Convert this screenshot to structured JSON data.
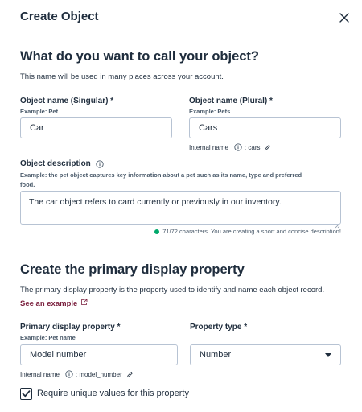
{
  "header": {
    "title": "Create Object"
  },
  "naming": {
    "heading": "What do you want to call your object?",
    "help": "This name will be used in many places across your account.",
    "singular": {
      "label": "Object name (Singular) *",
      "hint": "Example: Pet",
      "value": "Car"
    },
    "plural": {
      "label": "Object name (Plural) *",
      "hint": "Example: Pets",
      "value": "Cars"
    },
    "internal_name_label": "Internal name",
    "internal_name_value": ": cars",
    "description": {
      "label": "Object description",
      "hint_line1": "Example: the pet object captures key information about a pet such as its name, type and preferred",
      "hint_line2": "food.",
      "value": "The car object refers to card currently or previously in our inventory.",
      "counter": "71/72 characters. You are creating a short and concise description!"
    }
  },
  "display_property": {
    "heading": "Create the primary display property",
    "help": "The primary display property is the property used to identify and name each object record.",
    "link": "See an example",
    "primary": {
      "label": "Primary display property *",
      "hint": "Example: Pet name",
      "value": "Model number"
    },
    "type": {
      "label": "Property type *",
      "value": "Number"
    },
    "internal_name_label": "Internal name",
    "internal_name_value": ": model_number",
    "unique_label": "Require unique values for this property",
    "unique_checked": true
  },
  "colors": {
    "accent_link": "#7a1f3d",
    "status_ok": "#00a86b",
    "border": "#b7c3d3"
  }
}
